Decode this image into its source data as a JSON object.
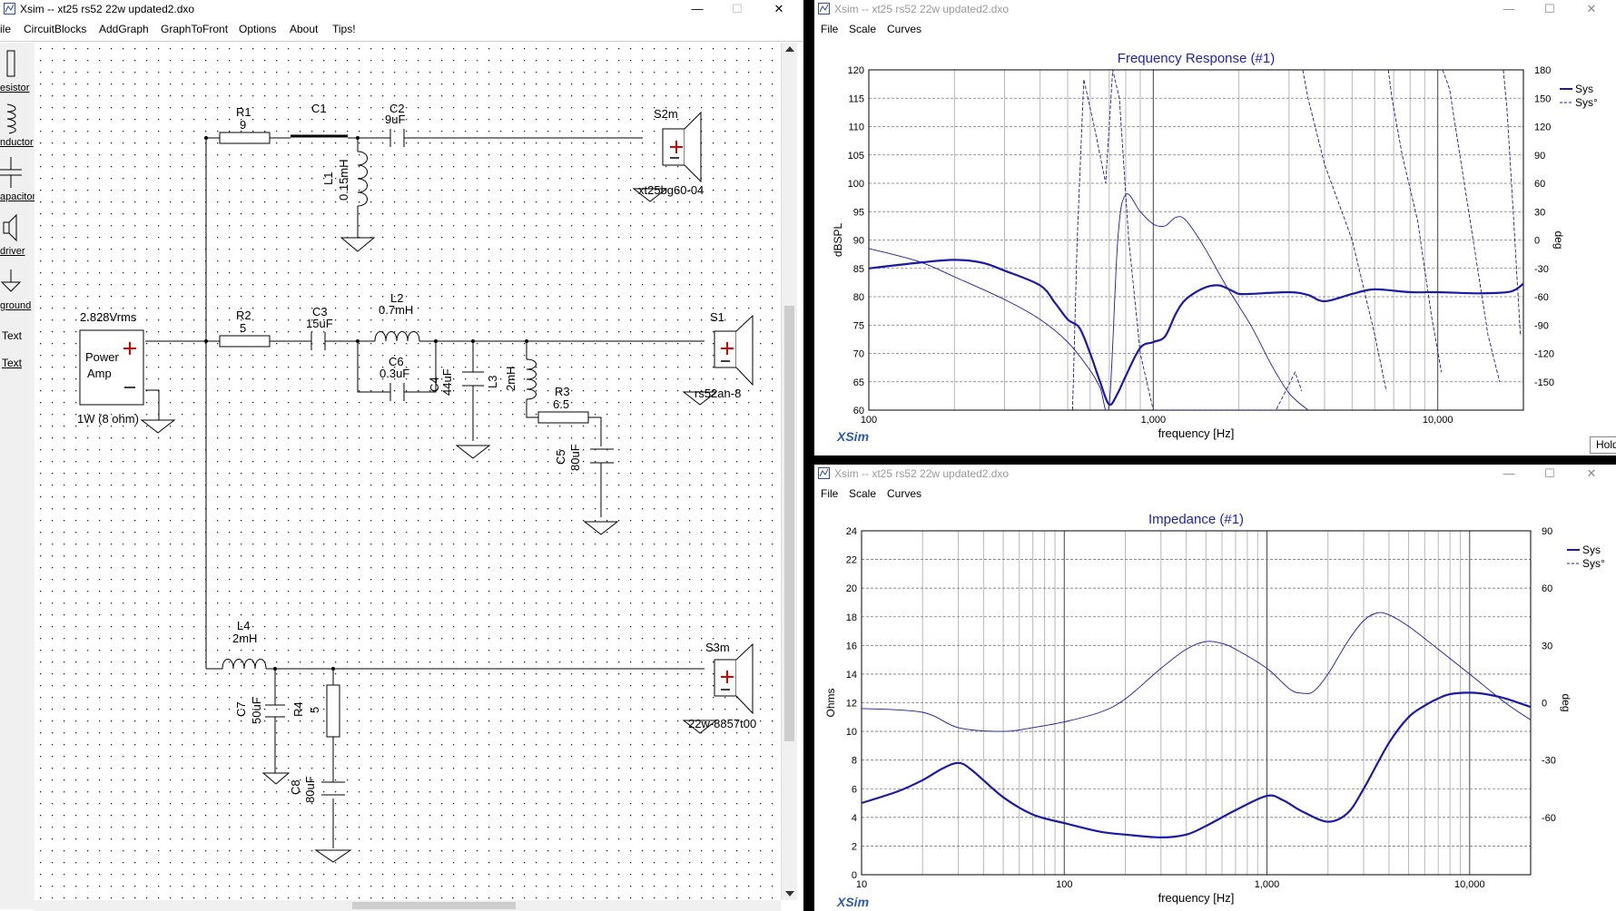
{
  "schematic": {
    "window_title": "Xsim -- xt25 rs52 22w updated2.dxo",
    "controls": {
      "minimize": "—",
      "maximize": "☐",
      "close": "✕"
    },
    "menu": [
      "ile",
      "CircuitBlocks",
      "AddGraph",
      "GraphToFront",
      "Options",
      "About",
      "Tips!"
    ],
    "toolbox": [
      "esistor",
      "nductor",
      "apacitor",
      "driver",
      "ground",
      "Text",
      "Text"
    ],
    "labels": {
      "R1": "R1",
      "R1v": "9",
      "C1": "C1",
      "C2": "C2",
      "C2v": "9uF",
      "L1": "L1",
      "L1v": "0.15mH",
      "S2m": "S2m",
      "S2m_model": "xt25bg60-04",
      "vrms": "2.828Vrms",
      "amp_line1": "Power",
      "amp_line2": "Amp",
      "power": "1W (8 ohm)",
      "R2": "R2",
      "R2v": "5",
      "C3": "C3",
      "C3v": "15uF",
      "L2": "L2",
      "L2v": "0.7mH",
      "C6": "C6",
      "C6v": "0.3uF",
      "C4": "C4",
      "C4v": "44uF",
      "L3": "L3",
      "L3v": "2mH",
      "R3": "R3",
      "R3v": "6.5",
      "C5": "C5",
      "C5v": "80uF",
      "S1": "S1",
      "S1_model": "rs52an-8",
      "L4": "L4",
      "L4v": "2mH",
      "C7": "C7",
      "C7v": "50uF",
      "R4": "R4",
      "R4v": "5",
      "C8": "C8",
      "C8v": "80uF",
      "S3m": "S3m",
      "S3m_model": "22w-8857t00"
    }
  },
  "freq_window": {
    "window_title": "Xsim -- xt25 rs52 22w updated2.dxo",
    "menu": [
      "File",
      "Scale",
      "Curves"
    ],
    "brand": "XSim",
    "hold_button": "Hold"
  },
  "imp_window": {
    "window_title": "Xsim -- xt25 rs52 22w updated2.dxo",
    "menu": [
      "File",
      "Scale",
      "Curves"
    ],
    "brand": "XSim"
  },
  "colors": {
    "curve": "#1a1aa6",
    "title": "#2020c0",
    "minor_grid": "#b8b8b8"
  },
  "chart_data": [
    {
      "type": "line",
      "title": "Frequency Response (#1)",
      "xlabel": "frequency [Hz]",
      "ylabel": "dBSPL",
      "y2label": "deg",
      "x_scale": "log",
      "xlim": [
        100,
        20000
      ],
      "ylim": [
        60,
        120
      ],
      "y2lim": [
        -180,
        180
      ],
      "x_ticks": [
        100,
        1000,
        10000
      ],
      "x_tick_labels": [
        "100",
        "1,000",
        "10,000"
      ],
      "y_ticks": [
        60,
        65,
        70,
        75,
        80,
        85,
        90,
        95,
        100,
        105,
        110,
        115,
        120
      ],
      "y2_ticks": [
        -150,
        -120,
        -90,
        -60,
        -30,
        0,
        30,
        60,
        90,
        120,
        150,
        180
      ],
      "grid": true,
      "legend_position": "top-right",
      "series": [
        {
          "name": "Sys",
          "axis": "left",
          "style": "solid-thick",
          "x": [
            100,
            150,
            200,
            250,
            300,
            400,
            450,
            500,
            550,
            600,
            650,
            700,
            750,
            800,
            900,
            1000,
            1100,
            1200,
            1300,
            1500,
            1700,
            1900,
            2000,
            2200,
            3000,
            3500,
            4000,
            5000,
            6000,
            8000,
            10000,
            14000,
            18000,
            20000
          ],
          "y": [
            85,
            86,
            86.5,
            86,
            84.6,
            82,
            79,
            76,
            74.5,
            70,
            65,
            61,
            63,
            66,
            71,
            72,
            73,
            77,
            79.5,
            81.5,
            82,
            81,
            80.5,
            80.5,
            80.8,
            80.3,
            79.2,
            80.5,
            81.3,
            80.8,
            80.8,
            80.6,
            80.9,
            82.3
          ]
        },
        {
          "name": "",
          "axis": "left",
          "style": "solid-thin",
          "x": [
            100,
            150,
            200,
            300,
            400,
            500,
            600,
            650,
            700,
            750,
            800,
            900,
            1000,
            1100,
            1200,
            1300,
            1500,
            1800,
            2200,
            2600,
            3000,
            3500
          ],
          "y": [
            88.5,
            86.2,
            83.5,
            79.5,
            76,
            72,
            67,
            64,
            61,
            90,
            98,
            95,
            92.8,
            92.5,
            94,
            93.5,
            89,
            82,
            75,
            68,
            63,
            60
          ]
        },
        {
          "name": "Sys°",
          "axis": "right",
          "style": "dashed",
          "x": [
            520,
            540,
            570,
            620,
            680,
            720,
            760,
            820,
            900,
            1000,
            1200,
            1500,
            2000,
            2700,
            3150,
            3330,
            3350,
            3500,
            4000,
            5000,
            6000,
            6600,
            6700,
            6900,
            7500,
            8500,
            9500,
            10300,
            10400,
            11000,
            13000,
            15000,
            16500,
            17000,
            17500,
            18500,
            19500
          ],
          "y": [
            -180,
            0,
            170,
            120,
            60,
            180,
            150,
            0,
            -120,
            -180,
            -180,
            -180,
            -180,
            -180,
            -140,
            -160,
            180,
            150,
            80,
            0,
            -100,
            -160,
            180,
            150,
            90,
            20,
            -80,
            -140,
            180,
            160,
            20,
            -100,
            -150,
            180,
            140,
            20,
            -100
          ]
        }
      ]
    },
    {
      "type": "line",
      "title": "Impedance (#1)",
      "xlabel": "frequency [Hz]",
      "ylabel": "Ohms",
      "y2label": "deg",
      "x_scale": "log",
      "xlim": [
        10,
        20000
      ],
      "ylim": [
        0,
        24
      ],
      "y2lim": [
        -90,
        90
      ],
      "x_ticks": [
        10,
        100,
        1000,
        10000
      ],
      "x_tick_labels": [
        "10",
        "100",
        "1,000",
        "10,000"
      ],
      "y_ticks": [
        0,
        2,
        4,
        6,
        8,
        10,
        12,
        14,
        16,
        18,
        20,
        22,
        24
      ],
      "y2_ticks": [
        -60,
        -30,
        0,
        30,
        60,
        90
      ],
      "grid": true,
      "legend_position": "top-right",
      "series": [
        {
          "name": "Sys",
          "axis": "left",
          "style": "solid-thick",
          "x": [
            10,
            15,
            20,
            25,
            30,
            35,
            50,
            70,
            100,
            150,
            200,
            300,
            400,
            500,
            700,
            1000,
            1200,
            1500,
            2000,
            2500,
            3000,
            4000,
            5000,
            6000,
            7000,
            8000,
            10000,
            12000,
            15000,
            20000
          ],
          "y": [
            5,
            5.8,
            6.6,
            7.4,
            7.8,
            7.3,
            5.4,
            4.2,
            3.6,
            3.0,
            2.8,
            2.6,
            2.8,
            3.4,
            4.5,
            5.5,
            5.2,
            4.4,
            3.7,
            4.3,
            6,
            9.2,
            11,
            11.8,
            12.3,
            12.6,
            12.7,
            12.6,
            12.3,
            11.7
          ]
        },
        {
          "name": "Sys°",
          "axis": "right",
          "style": "solid-thin",
          "x": [
            10,
            20,
            30,
            50,
            70,
            100,
            150,
            200,
            300,
            400,
            500,
            600,
            700,
            1000,
            1300,
            1500,
            1700,
            2000,
            2500,
            3000,
            3500,
            4000,
            5000,
            7000,
            10000,
            15000,
            20000
          ],
          "y": [
            -3,
            -5,
            -13,
            -15,
            -13,
            -10,
            -5,
            2,
            18,
            28,
            32,
            31,
            28,
            18,
            7,
            5,
            6,
            15,
            32,
            43,
            47,
            46,
            40,
            28,
            15,
            0,
            -9
          ]
        }
      ]
    }
  ]
}
